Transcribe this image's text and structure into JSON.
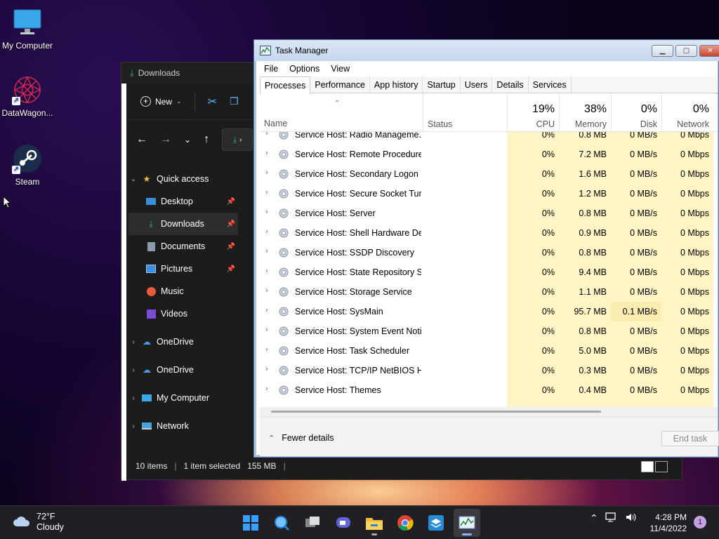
{
  "desktop": {
    "icons": [
      {
        "label": "My Computer"
      },
      {
        "label": "DataWagon..."
      },
      {
        "label": "Steam"
      }
    ]
  },
  "explorer": {
    "title": "Downloads",
    "new_label": "New",
    "nav": [
      {
        "label": "Quick access",
        "icon": "star-icon"
      },
      {
        "label": "Desktop",
        "icon": "desktop-icon"
      },
      {
        "label": "Downloads",
        "icon": "download-icon"
      },
      {
        "label": "Documents",
        "icon": "document-icon"
      },
      {
        "label": "Pictures",
        "icon": "pictures-icon"
      },
      {
        "label": "Music",
        "icon": "music-icon"
      },
      {
        "label": "Videos",
        "icon": "videos-icon"
      },
      {
        "label": "OneDrive",
        "icon": "cloud-icon"
      },
      {
        "label": "OneDrive",
        "icon": "cloud-icon"
      },
      {
        "label": "My Computer",
        "icon": "computer-icon"
      },
      {
        "label": "Network",
        "icon": "network-icon"
      }
    ],
    "status": {
      "items": "10 items",
      "selected": "1 item selected",
      "size": "155 MB"
    }
  },
  "taskmgr": {
    "title": "Task Manager",
    "menu": [
      "File",
      "Options",
      "View"
    ],
    "tabs": [
      "Processes",
      "Performance",
      "App history",
      "Startup",
      "Users",
      "Details",
      "Services"
    ],
    "header": {
      "name": "Name",
      "status": "Status",
      "cpu_pct": "19%",
      "cpu": "CPU",
      "mem_pct": "38%",
      "mem": "Memory",
      "disk_pct": "0%",
      "disk": "Disk",
      "net_pct": "0%",
      "net": "Network"
    },
    "rows": [
      {
        "name": "Service Host: Radio Manageme...",
        "cpu": "0%",
        "mem": "0.8 MB",
        "disk": "0 MB/s",
        "net": "0 Mbps"
      },
      {
        "name": "Service Host: Remote Procedure...",
        "cpu": "0%",
        "mem": "7.2 MB",
        "disk": "0 MB/s",
        "net": "0 Mbps"
      },
      {
        "name": "Service Host: Secondary Logon",
        "cpu": "0%",
        "mem": "1.6 MB",
        "disk": "0 MB/s",
        "net": "0 Mbps"
      },
      {
        "name": "Service Host: Secure Socket Tun...",
        "cpu": "0%",
        "mem": "1.2 MB",
        "disk": "0 MB/s",
        "net": "0 Mbps"
      },
      {
        "name": "Service Host: Server",
        "cpu": "0%",
        "mem": "0.8 MB",
        "disk": "0 MB/s",
        "net": "0 Mbps"
      },
      {
        "name": "Service Host: Shell Hardware De...",
        "cpu": "0%",
        "mem": "0.9 MB",
        "disk": "0 MB/s",
        "net": "0 Mbps"
      },
      {
        "name": "Service Host: SSDP Discovery",
        "cpu": "0%",
        "mem": "0.8 MB",
        "disk": "0 MB/s",
        "net": "0 Mbps"
      },
      {
        "name": "Service Host: State Repository S...",
        "cpu": "0%",
        "mem": "9.4 MB",
        "disk": "0 MB/s",
        "net": "0 Mbps"
      },
      {
        "name": "Service Host: Storage Service",
        "cpu": "0%",
        "mem": "1.1 MB",
        "disk": "0 MB/s",
        "net": "0 Mbps"
      },
      {
        "name": "Service Host: SysMain",
        "cpu": "0%",
        "mem": "95.7 MB",
        "disk": "0.1 MB/s",
        "net": "0 Mbps"
      },
      {
        "name": "Service Host: System Event Noti...",
        "cpu": "0%",
        "mem": "0.8 MB",
        "disk": "0 MB/s",
        "net": "0 Mbps"
      },
      {
        "name": "Service Host: Task Scheduler",
        "cpu": "0%",
        "mem": "5.0 MB",
        "disk": "0 MB/s",
        "net": "0 Mbps"
      },
      {
        "name": "Service Host: TCP/IP NetBIOS H...",
        "cpu": "0%",
        "mem": "0.3 MB",
        "disk": "0 MB/s",
        "net": "0 Mbps"
      },
      {
        "name": "Service Host: Themes",
        "cpu": "0%",
        "mem": "0.4 MB",
        "disk": "0 MB/s",
        "net": "0 Mbps"
      }
    ],
    "fewer_details": "Fewer details",
    "end_task": "End task"
  },
  "taskbar": {
    "weather": {
      "temp": "72°F",
      "desc": "Cloudy"
    },
    "apps": [
      "start-icon",
      "search-icon",
      "task-view-icon",
      "chat-icon",
      "file-explorer-icon",
      "chrome-icon",
      "app-icon",
      "task-manager-icon"
    ],
    "clock": {
      "time": "4:28 PM",
      "date": "11/4/2022"
    },
    "notifications": "1"
  },
  "colors": {
    "accent": "#ffbf00",
    "cpu_heat": "#fff4c4",
    "taskbar": "#1f1f24"
  }
}
